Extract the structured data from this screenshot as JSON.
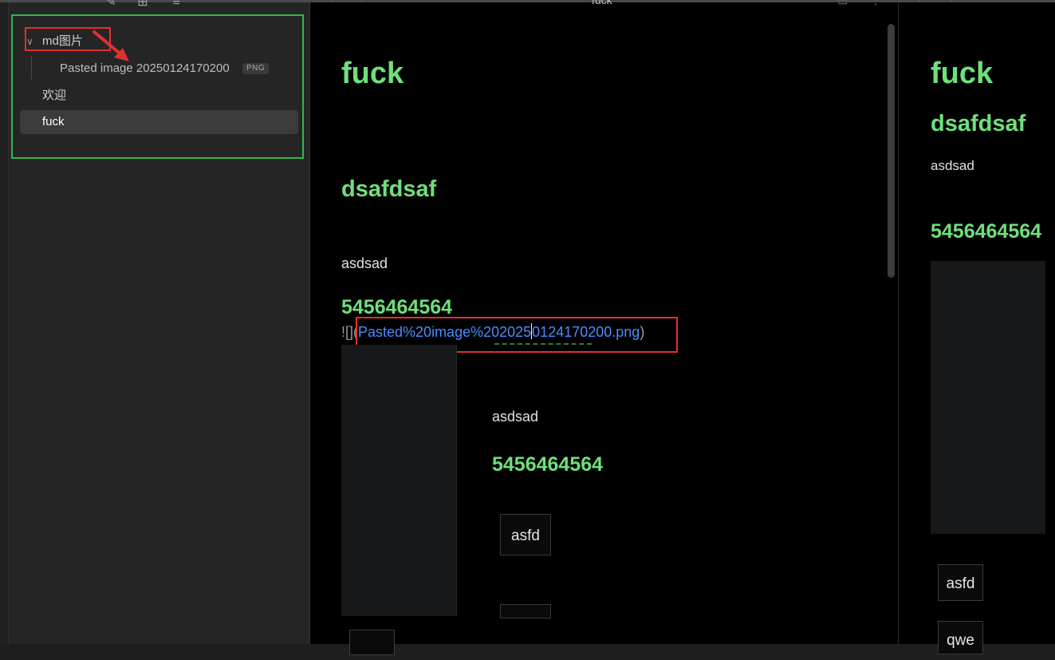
{
  "sidebar": {
    "toolbar_icons": [
      "new-note-icon",
      "new-folder-icon",
      "sort-icon",
      "collapse-icon"
    ],
    "tree": {
      "folder": {
        "label": "md图片",
        "expanded": true
      },
      "folder_children": [
        {
          "label": "Pasted image 20250124170200",
          "badge": "PNG"
        }
      ],
      "items": [
        {
          "label": "欢迎",
          "active": false
        },
        {
          "label": "fuck",
          "active": true
        }
      ]
    }
  },
  "tab": {
    "title": "fuck"
  },
  "editor": {
    "h1": "fuck",
    "h2": "dsafdsaf",
    "p1": "asdsad",
    "h3": "5456464564",
    "link_prefix": "![](",
    "link_url_before_cursor": "Pasted%20image%202025",
    "link_url_after_cursor": "0124170200.png",
    "link_suffix": ")",
    "embed": {
      "p": "asdsad",
      "h3": "5456464564",
      "cell": "asfd"
    }
  },
  "preview": {
    "h1": "fuck",
    "h2": "dsafdsaf",
    "p1": "asdsad",
    "h3": "5456464564",
    "cells": [
      "asfd",
      "qwe"
    ]
  },
  "colors": {
    "heading": "#6ee07a",
    "link": "#4a8cff",
    "annotation_red": "#e03030",
    "annotation_green": "#2fb84a"
  }
}
